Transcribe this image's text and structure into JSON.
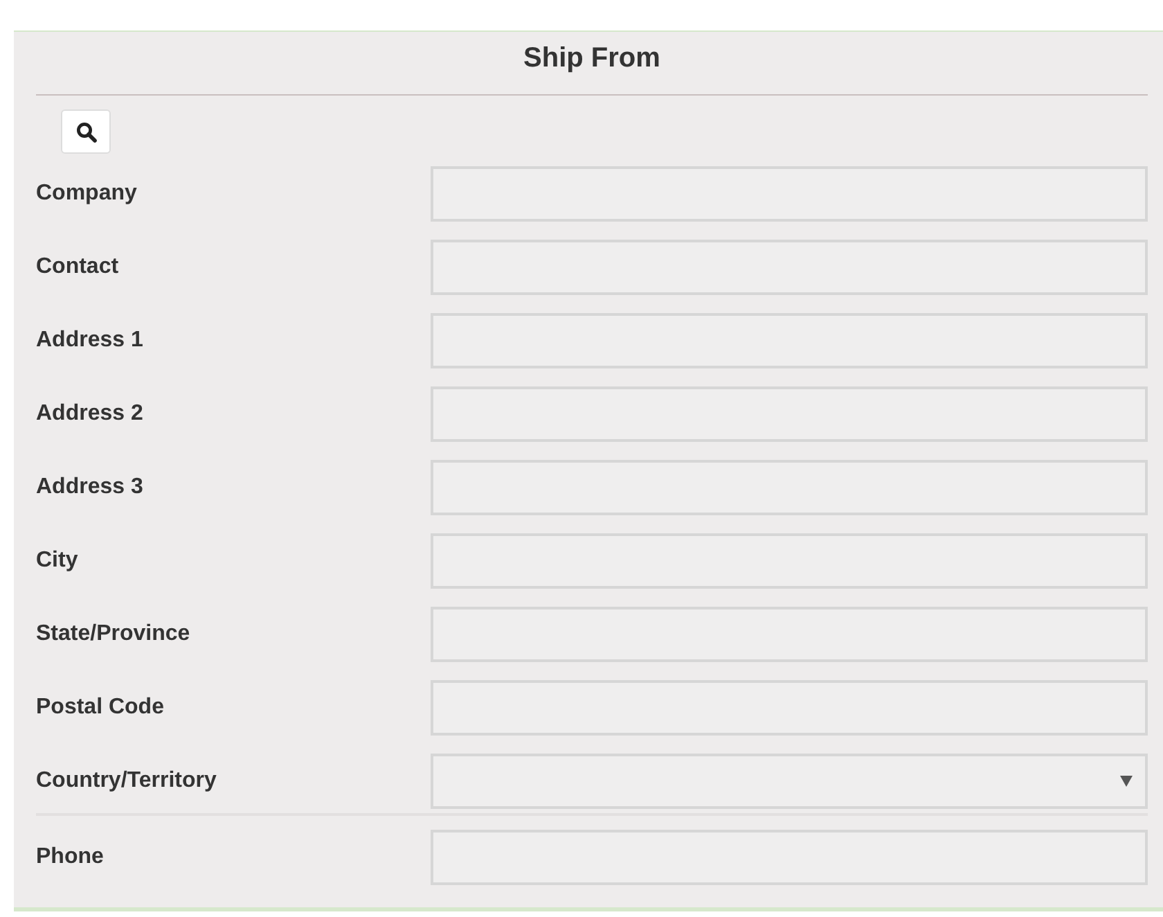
{
  "panel": {
    "title": "Ship From"
  },
  "fields": [
    {
      "label": "Company",
      "kind": "text"
    },
    {
      "label": "Contact",
      "kind": "text"
    },
    {
      "label": "Address 1",
      "kind": "text"
    },
    {
      "label": "Address 2",
      "kind": "text"
    },
    {
      "label": "Address 3",
      "kind": "text"
    },
    {
      "label": "City",
      "kind": "text"
    },
    {
      "label": "State/Province",
      "kind": "text"
    },
    {
      "label": "Postal Code",
      "kind": "text"
    },
    {
      "label": "Country/Territory",
      "kind": "select"
    }
  ],
  "phone_fields": [
    {
      "label": "Phone",
      "kind": "text"
    }
  ]
}
